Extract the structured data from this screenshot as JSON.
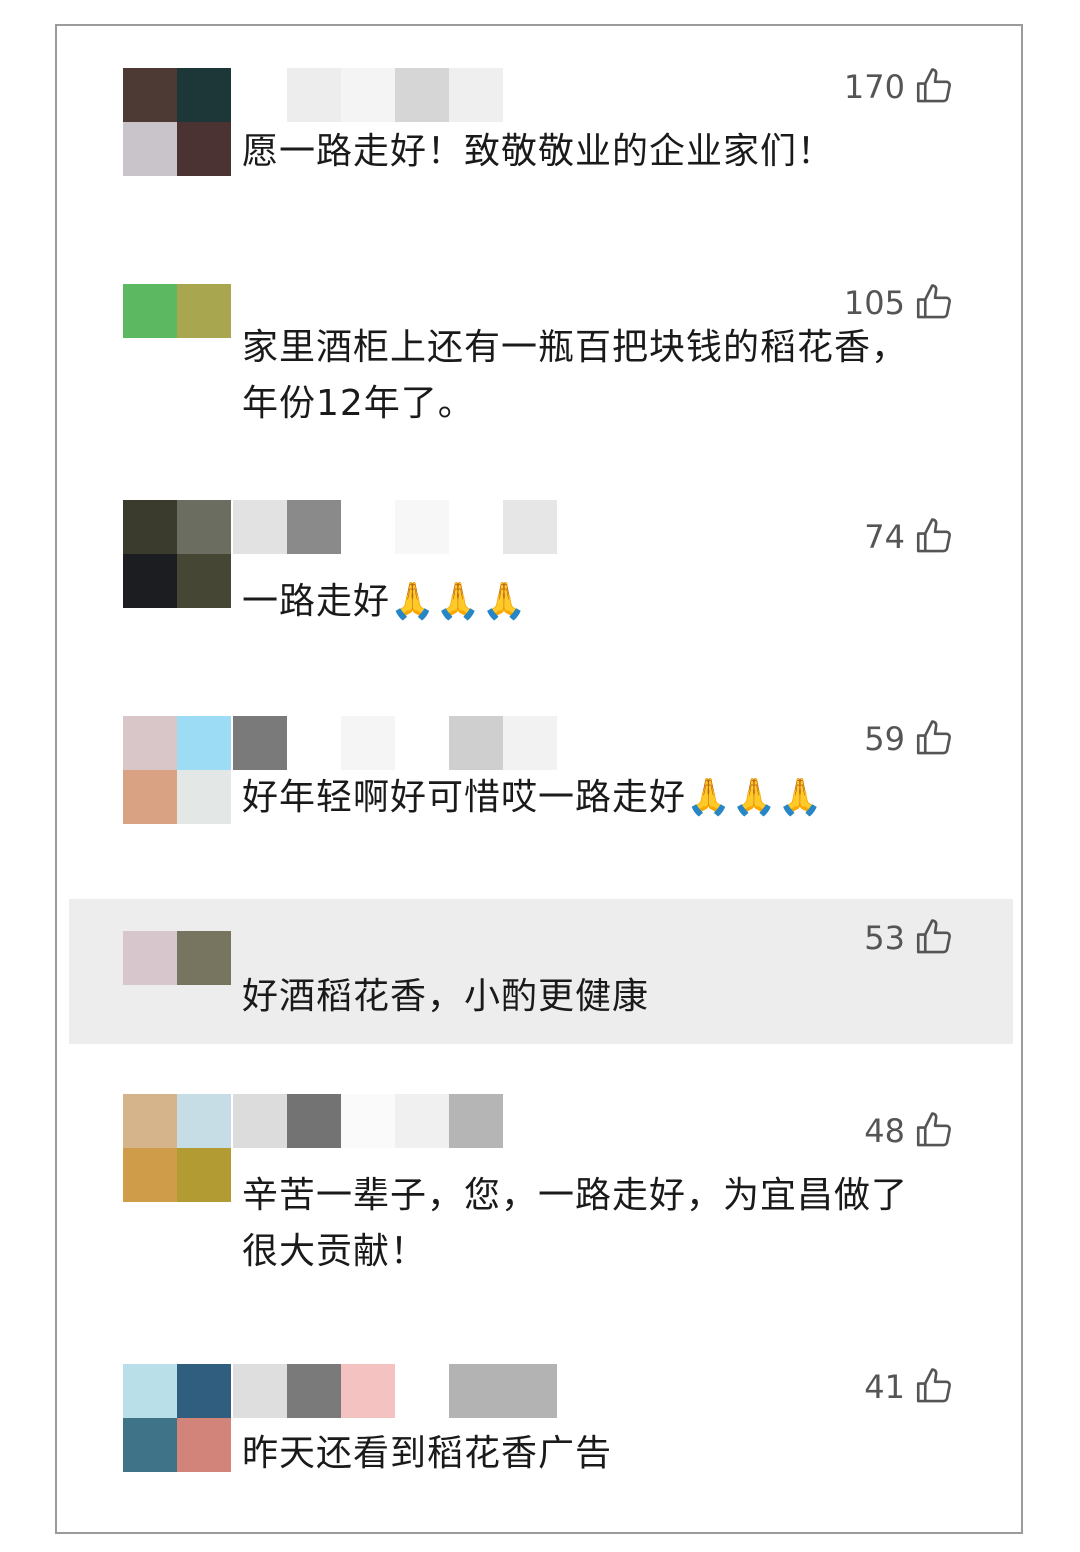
{
  "comments": [
    {
      "text": "愿一路走好！致敬敬业的企业家们！",
      "likes": "170",
      "avatar_colors": [
        "#4e3a35",
        "#1d3638",
        "#c9c4c9",
        "#4a3332"
      ],
      "name_blur": [
        "#ededed",
        "#f4f4f4",
        "#d6d6d6",
        "#efefef"
      ]
    },
    {
      "text": "家里酒柜上还有一瓶百把块钱的稻花香，\n年份12年了。",
      "likes": "105",
      "avatar_colors": [
        "#5cb861",
        "#a8a64f"
      ],
      "name_blur": []
    },
    {
      "text": "一路走好🙏🙏🙏",
      "likes": "74",
      "avatar_colors": [
        "#3a3a2d",
        "#6b6d60",
        "#1c1d20",
        "#454634"
      ],
      "name_blur": [
        "#e2e2e2",
        "#8a8a8a",
        "#ffffff",
        "#f7f7f7",
        "#ffffff",
        "#e6e6e6"
      ]
    },
    {
      "text": "好年轻啊好可惜哎一路走好🙏🙏🙏",
      "likes": "59",
      "avatar_colors": [
        "#d8c6c9",
        "#9ddcf5",
        "#d9a383",
        "#e3e8e6"
      ],
      "name_blur": [
        "#7a7a7a",
        "#ffffff",
        "#f5f5f5",
        "#ffffff",
        "#cfcfcf",
        "#f2f2f2"
      ]
    },
    {
      "text": "好酒稻花香，小酌更健康",
      "likes": "53",
      "avatar_colors": [
        "#d7c6cb",
        "#77755f"
      ],
      "name_blur": []
    },
    {
      "text": "辛苦一辈子，您，一路走好，为宜昌做了\n很大贡献！",
      "likes": "48",
      "avatar_colors": [
        "#d5b48b",
        "#c6dde6",
        "#cf9d49",
        "#b39b33"
      ],
      "name_blur": [
        "#dcdcdc",
        "#737373",
        "#fafafa",
        "#f0f0f0",
        "#b5b5b5"
      ]
    },
    {
      "text": "昨天还看到稻花香广告",
      "likes": "41",
      "avatar_colors": [
        "#b9dfe8",
        "#2f5e7e",
        "#3f7488",
        "#d2847a"
      ],
      "name_blur": [
        "#dedede",
        "#7a7a7a",
        "#f5c2c2",
        "#ffffff",
        "#b3b3b3",
        "#b3b3b3"
      ]
    }
  ],
  "icons": {
    "like": "thumbs-up-icon"
  }
}
